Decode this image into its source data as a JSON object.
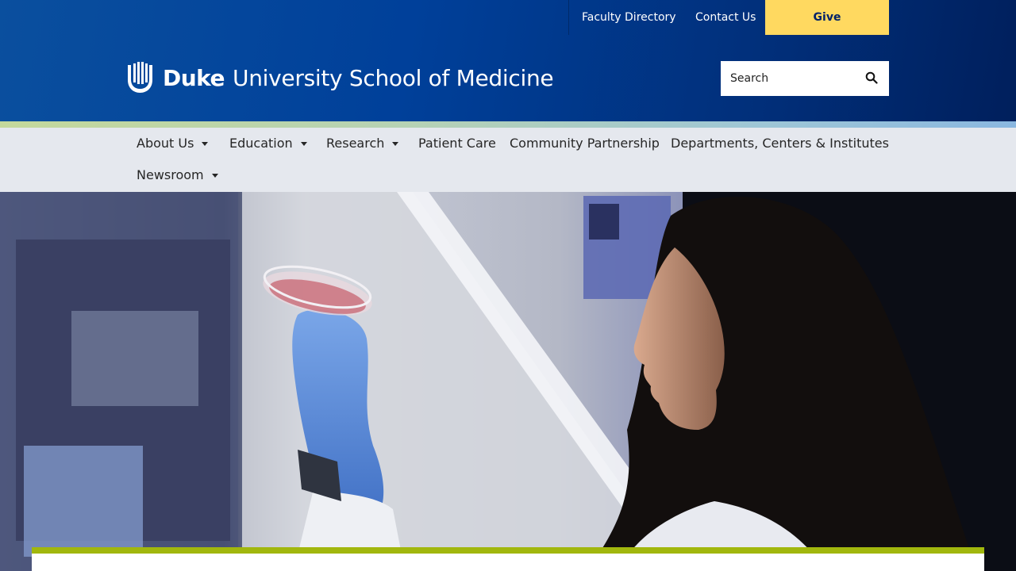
{
  "utility": {
    "faculty_directory": "Faculty Directory",
    "contact_us": "Contact Us",
    "give": "Give"
  },
  "brand": {
    "name_bold": "Duke",
    "name_rest": "University School of Medicine"
  },
  "search": {
    "placeholder": "Search",
    "value": ""
  },
  "nav": {
    "items": [
      {
        "label": "About Us",
        "dropdown": true
      },
      {
        "label": "Education",
        "dropdown": true
      },
      {
        "label": "Research",
        "dropdown": true
      },
      {
        "label": "Patient Care",
        "dropdown": false
      },
      {
        "label": "Community Partnership",
        "dropdown": false
      },
      {
        "label": "Departments, Centers & Institutes",
        "dropdown": false
      },
      {
        "label": "Newsroom",
        "dropdown": true
      }
    ]
  },
  "colors": {
    "header_blue": "#00409a",
    "header_navy": "#001f5c",
    "give_yellow": "#ffd960",
    "nav_bg": "#e5e8ee",
    "card_accent": "#a1b70d"
  },
  "icons": {
    "search": "search-icon",
    "logo": "duke-chapel-logo-icon",
    "dropdown": "caret-down-icon"
  }
}
